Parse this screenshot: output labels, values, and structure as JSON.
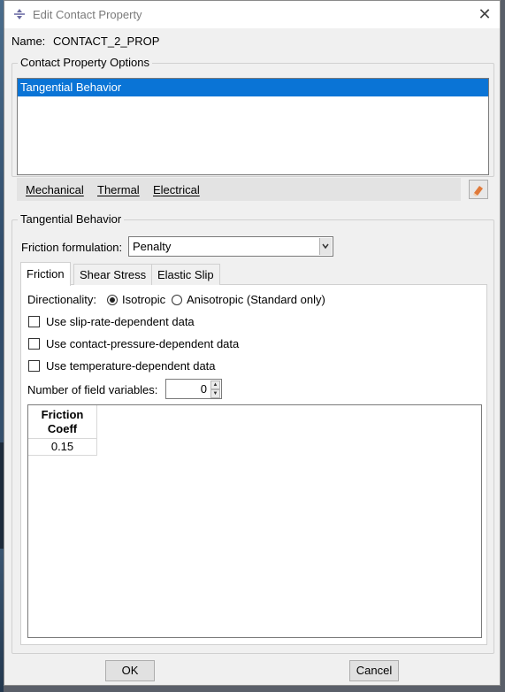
{
  "window": {
    "title": "Edit Contact Property"
  },
  "name_row": {
    "label": "Name:",
    "value": "CONTACT_2_PROP"
  },
  "options_group": {
    "title": "Contact Property Options",
    "items": [
      "Tangential Behavior"
    ],
    "selected_index": 0,
    "menu": [
      "Mechanical",
      "Thermal",
      "Electrical"
    ]
  },
  "behavior_group": {
    "title": "Tangential Behavior",
    "friction_label": "Friction formulation:",
    "friction_value": "Penalty",
    "tabs": [
      "Friction",
      "Shear Stress",
      "Elastic Slip"
    ],
    "active_tab": "Friction",
    "directionality": {
      "label": "Directionality:",
      "options": [
        "Isotropic",
        "Anisotropic (Standard only)"
      ],
      "selected": "Isotropic"
    },
    "checkboxes": [
      "Use slip-rate-dependent data",
      "Use contact-pressure-dependent data",
      "Use temperature-dependent data"
    ],
    "field_vars_label": "Number of field variables:",
    "field_vars_value": "0",
    "table": {
      "header_line1": "Friction",
      "header_line2": "Coeff",
      "rows": [
        "0.15"
      ]
    }
  },
  "buttons": {
    "ok": "OK",
    "cancel": "Cancel"
  },
  "colors": {
    "selection": "#0a74d6",
    "dialog_bg": "#f0f0f0",
    "window_border": "#8a8a8a"
  }
}
